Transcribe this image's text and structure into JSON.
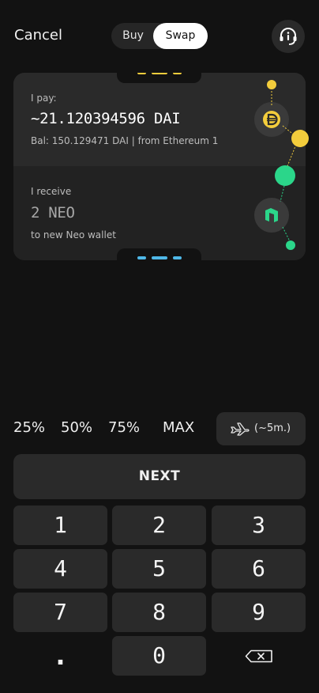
{
  "header": {
    "cancel_label": "Cancel",
    "segment": {
      "options": [
        "Buy",
        "Swap"
      ],
      "selected": "Swap"
    },
    "help_icon": "headset-info-icon"
  },
  "pay": {
    "label": "I pay:",
    "amount": "~21.120394596 DAI",
    "balance": "Bal: 150.129471 DAI | from Ethereum 1",
    "coin_icon": "dai-icon",
    "accent": "#f3cd3c"
  },
  "receive": {
    "label": "I receive",
    "amount": "2 NEO",
    "destination": "to new Neo wallet",
    "coin_icon": "neo-icon",
    "accent": "#2bd68a"
  },
  "presets": [
    "25%",
    "50%",
    "75%",
    "MAX"
  ],
  "speed": {
    "label": "(~5m.)",
    "icon": "airplane-icon"
  },
  "next_label": "NEXT",
  "keypad": [
    "1",
    "2",
    "3",
    "4",
    "5",
    "6",
    "7",
    "8",
    "9",
    ".",
    "0",
    "backspace"
  ],
  "colors": {
    "background": "#121212",
    "surface": "#2a2a2a",
    "yellow": "#f3cd3c",
    "green": "#2bd68a",
    "blue": "#4fb8e8"
  }
}
